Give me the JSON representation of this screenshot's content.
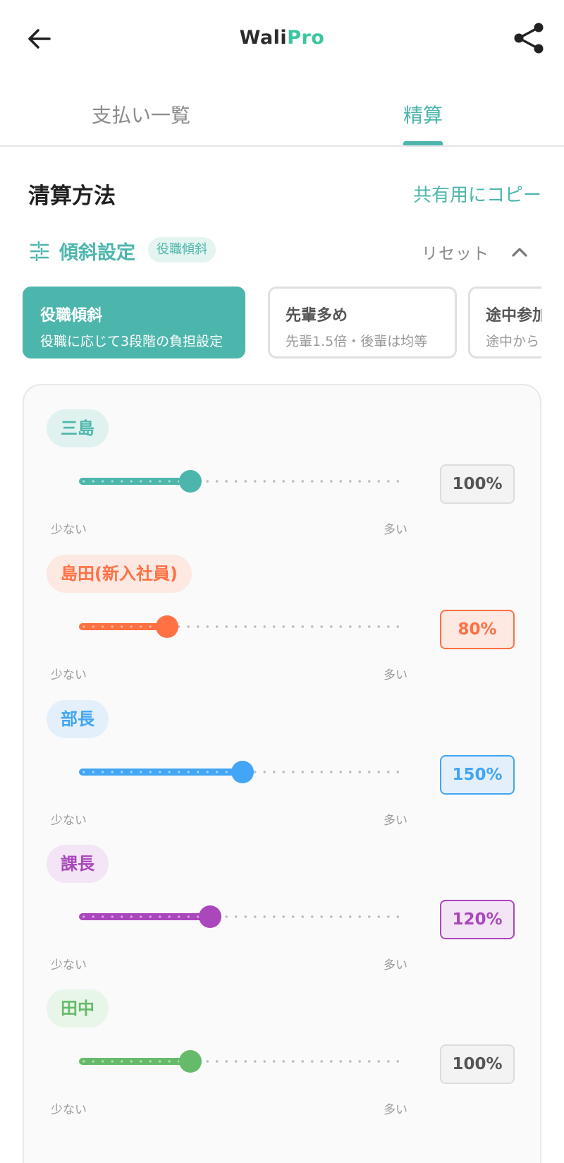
{
  "header": {
    "logo_part1": "Wali",
    "logo_part2": "Pro",
    "back_icon": "arrow-left-icon",
    "share_icon": "share-icon"
  },
  "tabs": [
    {
      "label": "支払い一覧",
      "active": false
    },
    {
      "label": "精算",
      "active": true
    }
  ],
  "section": {
    "title": "清算方法",
    "copy_label": "共有用にコピー"
  },
  "tilt": {
    "title": "傾斜設定",
    "chip": "役職傾斜",
    "reset_label": "リセット",
    "icon": "tune-icon",
    "collapse_icon": "chevron-up-icon"
  },
  "presets": [
    {
      "title": "役職傾斜",
      "desc": "役職に応じて3段階の負担設定",
      "active": true
    },
    {
      "title": "先輩多め",
      "desc": "先輩1.5倍・後輩は均等",
      "active": false
    },
    {
      "title": "途中参加",
      "desc": "途中から",
      "active": false
    }
  ],
  "members": [
    {
      "name": "三島",
      "percent_label": "100%",
      "level": 0.34,
      "color": "#4db6ac",
      "chip_bg": "#e0f2ef",
      "highlight": false
    },
    {
      "name": "島田(新入社員)",
      "percent_label": "80%",
      "level": 0.27,
      "color": "#ff7043",
      "chip_bg": "#fde8e2",
      "highlight": true
    },
    {
      "name": "部長",
      "percent_label": "150%",
      "level": 0.5,
      "color": "#42a5f5",
      "chip_bg": "#e3f0fb",
      "highlight": true
    },
    {
      "name": "課長",
      "percent_label": "120%",
      "level": 0.4,
      "color": "#ab47bc",
      "chip_bg": "#f3e5f5",
      "highlight": true
    },
    {
      "name": "田中",
      "percent_label": "100%",
      "level": 0.34,
      "color": "#66bb6a",
      "chip_bg": "#e8f5e9",
      "highlight": false
    }
  ],
  "slider_labels": {
    "min": "少ない",
    "max": "多い"
  }
}
